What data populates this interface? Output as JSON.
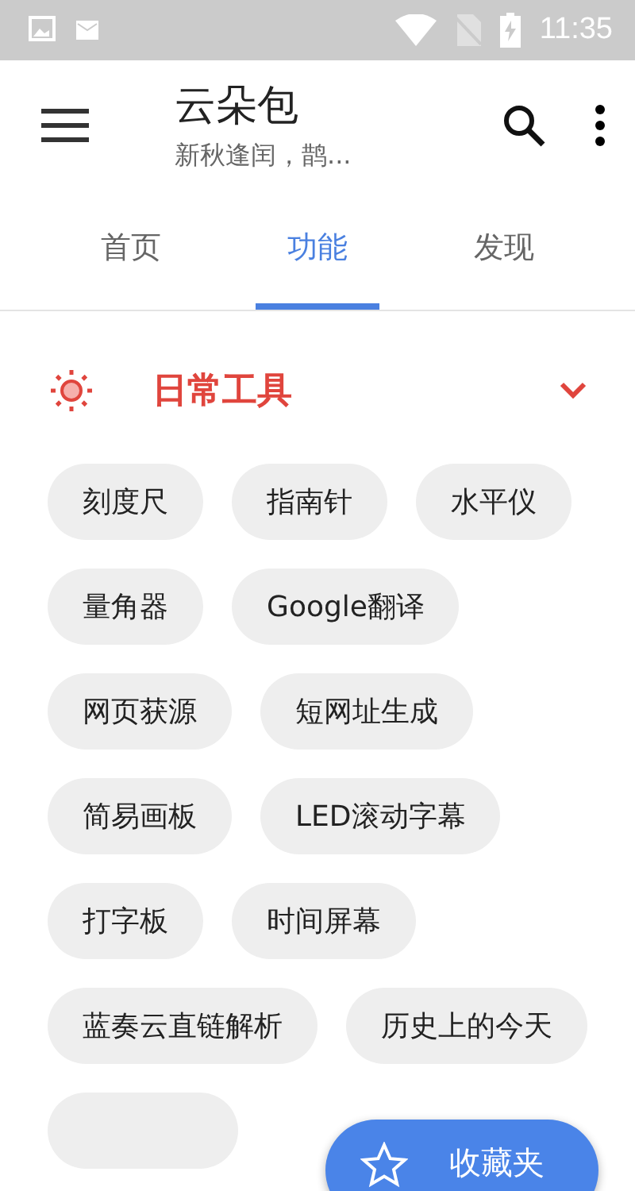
{
  "status_bar": {
    "time": "11:35"
  },
  "app_bar": {
    "title": "云朵包",
    "subtitle": "新秋逢闰，鹊..."
  },
  "tabs": [
    {
      "label": "首页",
      "selected": false
    },
    {
      "label": "功能",
      "selected": true
    },
    {
      "label": "发现",
      "selected": false
    }
  ],
  "section": {
    "title": "日常工具",
    "expanded": true,
    "chips": [
      {
        "label": "刻度尺"
      },
      {
        "label": "指南针"
      },
      {
        "label": "水平仪"
      },
      {
        "label": "量角器"
      },
      {
        "label": "Google翻译"
      },
      {
        "label": "网页获源"
      },
      {
        "label": "短网址生成"
      },
      {
        "label": "简易画板"
      },
      {
        "label": "LED滚动字幕"
      },
      {
        "label": "打字板"
      },
      {
        "label": "时间屏幕"
      },
      {
        "label": "蓝奏云直链解析"
      },
      {
        "label": "历史上的今天"
      },
      {
        "kind": "covered"
      }
    ]
  },
  "fab": {
    "label": "收藏夹"
  }
}
